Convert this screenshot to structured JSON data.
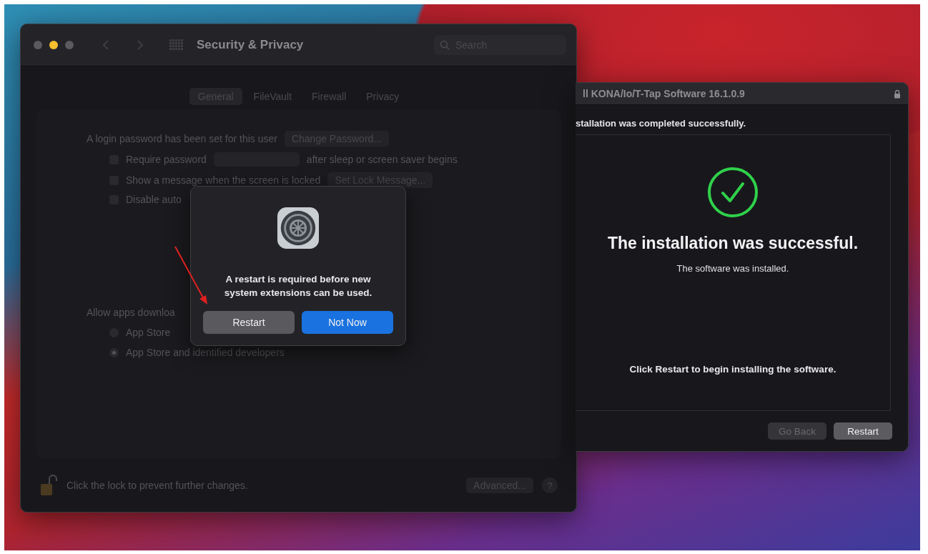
{
  "settings_window": {
    "title": "Security & Privacy",
    "search": {
      "placeholder": "Search"
    },
    "tabs": [
      {
        "label": "General",
        "selected": true
      },
      {
        "label": "FileVault",
        "selected": false
      },
      {
        "label": "Firewall",
        "selected": false
      },
      {
        "label": "Privacy",
        "selected": false
      }
    ],
    "password_text": "A login password has been set for this user",
    "change_password": "Change Password...",
    "options": [
      {
        "label": "Require password",
        "checked": false,
        "popup": true,
        "suffix": "after sleep or screen saver begins"
      },
      {
        "label": "Show a message when the screen is locked",
        "checked": false,
        "button": "Set Lock Message..."
      },
      {
        "label": "Disable auto",
        "checked": false
      }
    ],
    "allow_label": "Allow apps downloa",
    "radios": [
      {
        "label": "App Store",
        "selected": false
      },
      {
        "label": "App Store and identified developers",
        "selected": true
      }
    ],
    "lock_text": "Click the lock to prevent further changes.",
    "advanced": "Advanced...",
    "help": "?"
  },
  "dialog": {
    "message": "A restart is required before new system extensions can be used.",
    "buttons": [
      {
        "label": "Restart",
        "kind": "secondary"
      },
      {
        "label": "Not Now",
        "kind": "primary"
      }
    ]
  },
  "installer_window": {
    "title": "ll KONA/Io/T-Tap Software 16.1.0.9",
    "intro": "stallation was completed successfully.",
    "heading": "The installation was successful.",
    "subtext": "The software was installed.",
    "instruction": "Click Restart to begin installing the software.",
    "buttons": [
      {
        "label": "Go Back",
        "disabled": true
      },
      {
        "label": "Restart",
        "disabled": false
      }
    ]
  }
}
